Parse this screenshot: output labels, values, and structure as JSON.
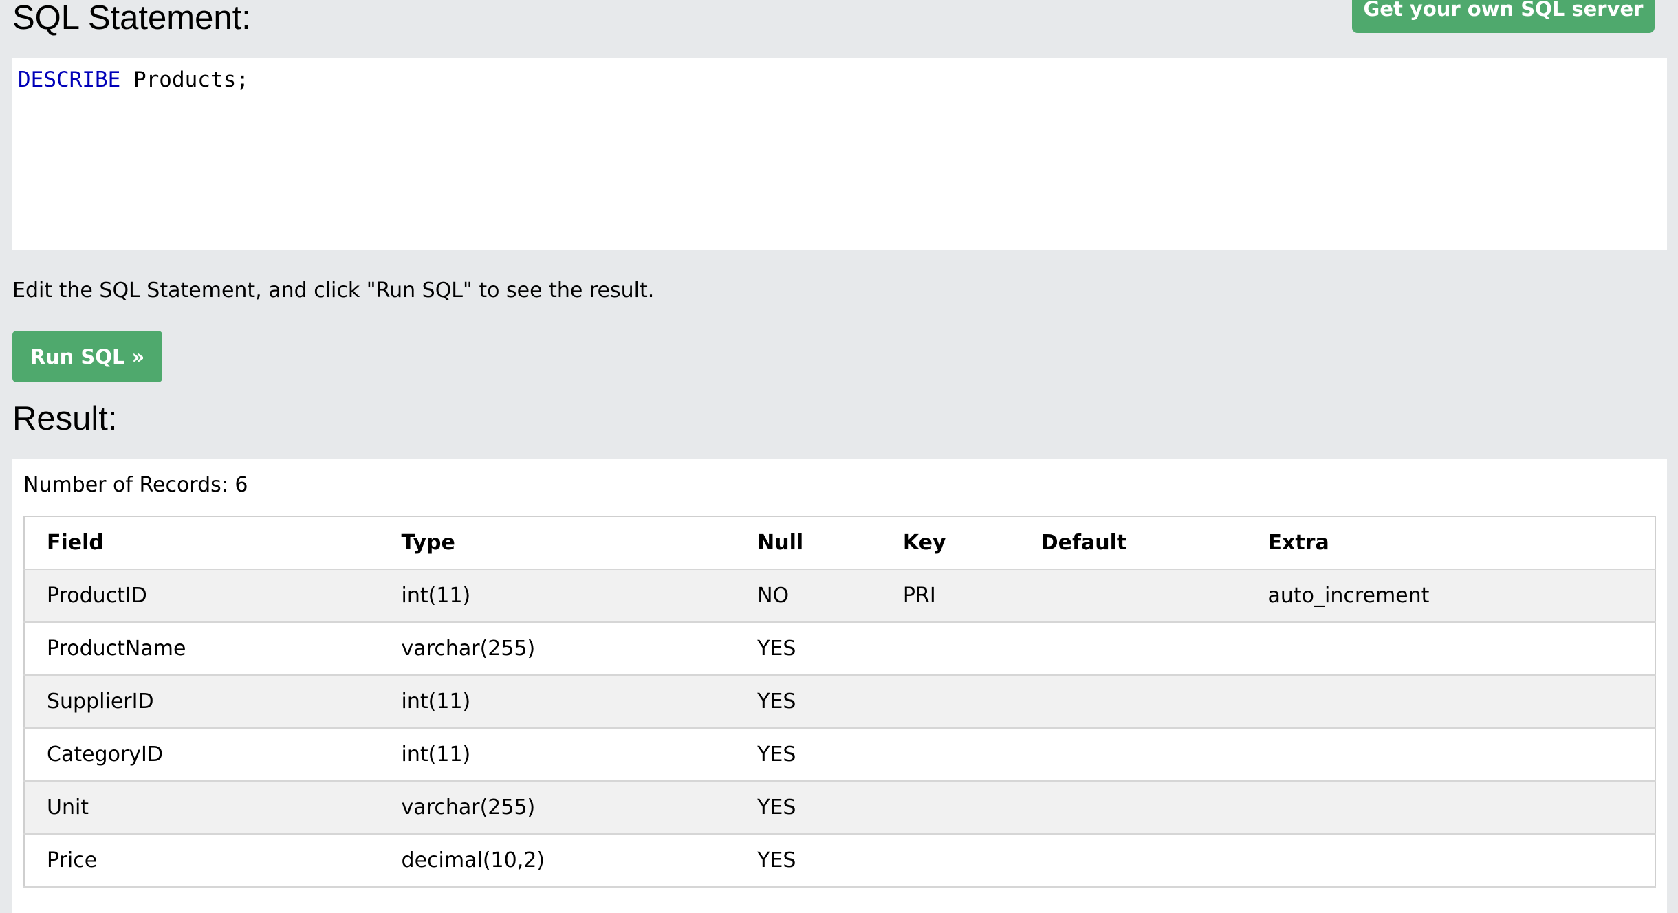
{
  "header": {
    "sql_title": "SQL Statement:",
    "own_server_label": "Get your own SQL server"
  },
  "editor": {
    "keyword": "DESCRIBE",
    "rest": " Products;"
  },
  "hint": "Edit the SQL Statement, and click \"Run SQL\" to see the result.",
  "run_button": "Run SQL »",
  "result": {
    "title": "Result:",
    "records_label": "Number of Records: 6",
    "columns": [
      "Field",
      "Type",
      "Null",
      "Key",
      "Default",
      "Extra"
    ],
    "rows": [
      [
        "ProductID",
        "int(11)",
        "NO",
        "PRI",
        "",
        "auto_increment"
      ],
      [
        "ProductName",
        "varchar(255)",
        "YES",
        "",
        "",
        ""
      ],
      [
        "SupplierID",
        "int(11)",
        "YES",
        "",
        "",
        ""
      ],
      [
        "CategoryID",
        "int(11)",
        "YES",
        "",
        "",
        ""
      ],
      [
        "Unit",
        "varchar(255)",
        "YES",
        "",
        "",
        ""
      ],
      [
        "Price",
        "decimal(10,2)",
        "YES",
        "",
        "",
        ""
      ]
    ]
  },
  "colors": {
    "page_bg": "#e7e9eb",
    "button_green": "#4fa96d",
    "keyword_blue": "#0000b8",
    "row_alt": "#f1f1f1"
  }
}
